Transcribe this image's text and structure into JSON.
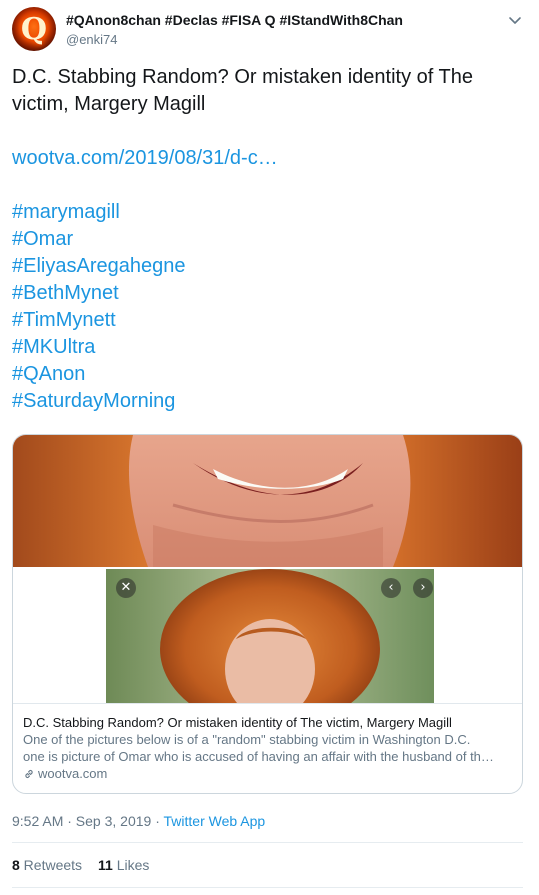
{
  "author": {
    "display_name": "#QAnon8chan #Declas #FISA Q #IStandWith8Chan",
    "handle": "@enki74",
    "avatar_letter": "Q"
  },
  "tweet": {
    "text_line1": "D.C. Stabbing Random? Or mistaken identity of The",
    "text_line2": "victim, Margery Magill",
    "link": "wootva.com/2019/08/31/d-c…",
    "hashtags": [
      "#marymagill",
      "#Omar",
      "#EliyasAregahegne",
      "#BethMynet",
      "#TimMynett",
      "#MKUltra",
      "#QAnon",
      "#SaturdayMorning"
    ]
  },
  "card": {
    "close_glyph": "✕",
    "prev_glyph": "‹",
    "next_glyph": "›",
    "title": "D.C. Stabbing Random? Or mistaken identity of The victim, Margery Magill",
    "desc_line1": "One of the pictures below is of a \"random\" stabbing victim in Washington D.C.",
    "desc_line2": "one is picture of Omar who is accused of having an affair with the husband of th…",
    "domain": "wootva.com"
  },
  "meta": {
    "time": "9:52 AM · Sep 3, 2019 · ",
    "source": "Twitter Web App"
  },
  "stats": {
    "retweets_count": "8",
    "retweets_label": " Retweets",
    "likes_count": "11",
    "likes_label": " Likes"
  },
  "colors": {
    "link_blue": "#1b95e0",
    "text": "#14171a",
    "secondary": "#657786",
    "border": "#ccd6dd"
  }
}
